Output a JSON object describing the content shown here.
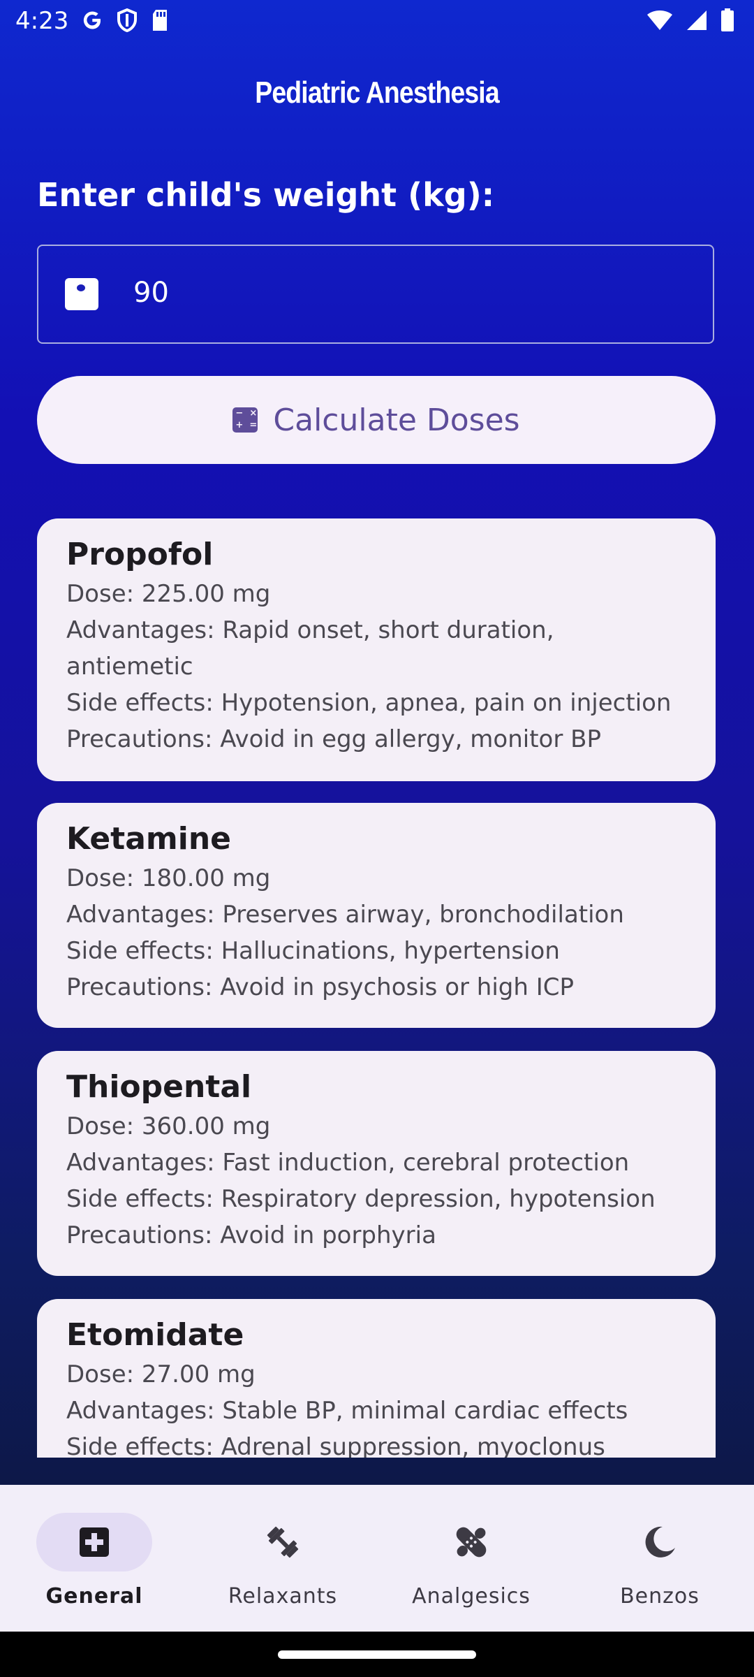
{
  "status_bar": {
    "time": "4:23",
    "icons": [
      "google-icon",
      "shield-icon",
      "sd-card-icon",
      "wifi-icon",
      "signal-icon",
      "battery-icon"
    ]
  },
  "header": {
    "title": "Pediatric Anesthesia"
  },
  "weight": {
    "label": "Enter child's weight (kg):",
    "value": "90",
    "icon": "scale-icon"
  },
  "calculate_button": {
    "label": "Calculate Doses",
    "icon": "calculate-icon"
  },
  "drugs": [
    {
      "name": "Propofol",
      "dose": "Dose: 225.00 mg",
      "advantages": "Advantages: Rapid onset, short duration, antiemetic",
      "side_effects": "Side effects: Hypotension, apnea, pain on injection",
      "precautions": "Precautions: Avoid in egg allergy, monitor BP"
    },
    {
      "name": "Ketamine",
      "dose": "Dose: 180.00 mg",
      "advantages": "Advantages: Preserves airway, bronchodilation",
      "side_effects": "Side effects: Hallucinations, hypertension",
      "precautions": "Precautions: Avoid in psychosis or high ICP"
    },
    {
      "name": "Thiopental",
      "dose": "Dose: 360.00 mg",
      "advantages": "Advantages: Fast induction, cerebral protection",
      "side_effects": "Side effects: Respiratory depression, hypotension",
      "precautions": "Precautions: Avoid in porphyria"
    },
    {
      "name": "Etomidate",
      "dose": "Dose: 27.00 mg",
      "advantages": "Advantages: Stable BP, minimal cardiac effects",
      "side_effects": "Side effects: Adrenal suppression, myoclonus"
    }
  ],
  "bottom_nav": {
    "items": [
      {
        "label": "General",
        "icon": "medical-plus-icon",
        "active": true
      },
      {
        "label": "Relaxants",
        "icon": "dumbbell-icon",
        "active": false
      },
      {
        "label": "Analgesics",
        "icon": "bandage-icon",
        "active": false
      },
      {
        "label": "Benzos",
        "icon": "moon-icon",
        "active": false
      }
    ]
  },
  "colors": {
    "background_top": "#0f28cf",
    "background_bottom": "#0d1848",
    "card_bg": "#f4eff7",
    "button_text": "#5e4d9a",
    "nav_bg": "#f2eef9",
    "nav_active_pill": "#e3dcf4"
  }
}
